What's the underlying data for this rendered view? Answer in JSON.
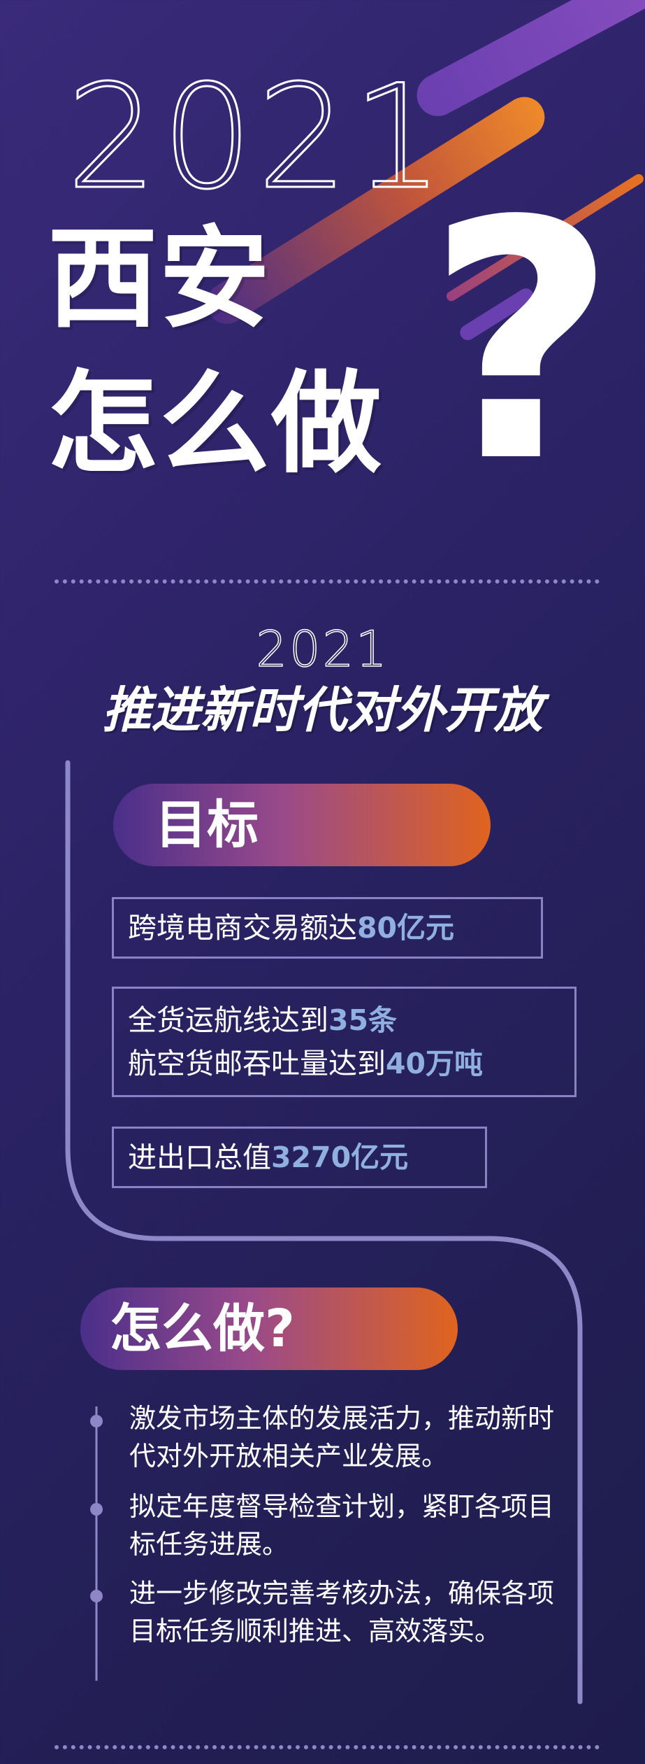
{
  "header": {
    "year": "2021",
    "title_line1": "西安",
    "title_line2": "怎么做",
    "question_mark": "?"
  },
  "section": {
    "year": "2021",
    "subtitle": "推进新时代对外开放"
  },
  "goals": {
    "heading": "目标",
    "items": [
      {
        "lines": [
          {
            "text": "跨境电商交易额达",
            "value": "80亿元"
          }
        ]
      },
      {
        "lines": [
          {
            "text": "全货运航线达到",
            "value": "35条"
          },
          {
            "text": "航空货邮吞吐量达到",
            "value": "40万吨"
          }
        ]
      },
      {
        "lines": [
          {
            "text": "进出口总值",
            "value": "3270亿元"
          }
        ]
      }
    ]
  },
  "how": {
    "heading": "怎么做?",
    "bullets": [
      "激发市场主体的发展活力，推动新时代对外开放相关产业发展。",
      "拟定年度督导检查计划，紧盯各项目标任务进展。",
      "进一步修改完善考核办法，确保各项目标任务顺利推进、高效落实。"
    ]
  },
  "colors": {
    "background": "#2a2264",
    "accent_orange": "#e8721e",
    "accent_purple": "#5a3aa0",
    "highlight_value": "#8fb0e0",
    "frame_line": "#8e88c9"
  }
}
